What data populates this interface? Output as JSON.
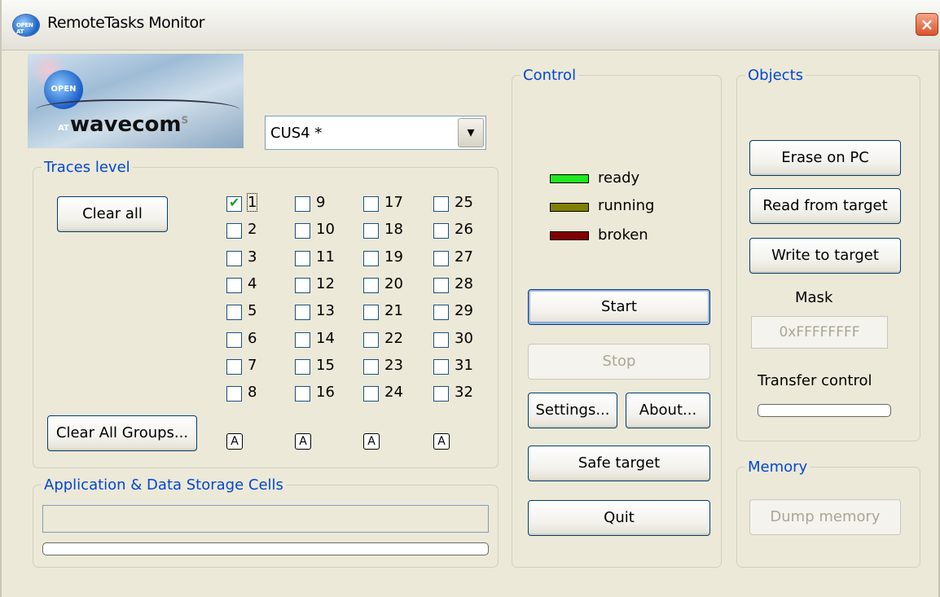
{
  "window": {
    "title": "RemoteTasks Monitor",
    "close_glyph": "×",
    "icon_text": "OPEN AT"
  },
  "logo": {
    "badge": "OPEN AT",
    "brand": "wavecom",
    "brand_superscript": "S"
  },
  "port_select": {
    "value": "CUS4 *",
    "arrow_glyph": "▾"
  },
  "traces": {
    "legend": "Traces level",
    "clear_all_label": "Clear all",
    "clear_groups_label": "Clear All Groups...",
    "group_button_label": "A",
    "levels": [
      {
        "n": "1",
        "checked": true
      },
      {
        "n": "2",
        "checked": false
      },
      {
        "n": "3",
        "checked": false
      },
      {
        "n": "4",
        "checked": false
      },
      {
        "n": "5",
        "checked": false
      },
      {
        "n": "6",
        "checked": false
      },
      {
        "n": "7",
        "checked": false
      },
      {
        "n": "8",
        "checked": false
      },
      {
        "n": "9",
        "checked": false
      },
      {
        "n": "10",
        "checked": false
      },
      {
        "n": "11",
        "checked": false
      },
      {
        "n": "12",
        "checked": false
      },
      {
        "n": "13",
        "checked": false
      },
      {
        "n": "14",
        "checked": false
      },
      {
        "n": "15",
        "checked": false
      },
      {
        "n": "16",
        "checked": false
      },
      {
        "n": "17",
        "checked": false
      },
      {
        "n": "18",
        "checked": false
      },
      {
        "n": "19",
        "checked": false
      },
      {
        "n": "20",
        "checked": false
      },
      {
        "n": "21",
        "checked": false
      },
      {
        "n": "22",
        "checked": false
      },
      {
        "n": "23",
        "checked": false
      },
      {
        "n": "24",
        "checked": false
      },
      {
        "n": "25",
        "checked": false
      },
      {
        "n": "26",
        "checked": false
      },
      {
        "n": "27",
        "checked": false
      },
      {
        "n": "28",
        "checked": false
      },
      {
        "n": "29",
        "checked": false
      },
      {
        "n": "30",
        "checked": false
      },
      {
        "n": "31",
        "checked": false
      },
      {
        "n": "32",
        "checked": false
      }
    ]
  },
  "storage": {
    "legend": "Application & Data Storage Cells",
    "field_value": "",
    "progress": 0
  },
  "control": {
    "legend": "Control",
    "status": [
      {
        "label": "ready",
        "color": "#1ee81e"
      },
      {
        "label": "running",
        "color": "#7f7f00"
      },
      {
        "label": "broken",
        "color": "#800000"
      }
    ],
    "start_label": "Start",
    "stop_label": "Stop",
    "settings_label": "Settings...",
    "about_label": "About...",
    "safe_target_label": "Safe target",
    "quit_label": "Quit"
  },
  "objects": {
    "legend": "Objects",
    "erase_label": "Erase on PC",
    "read_label": "Read from target",
    "write_label": "Write to target",
    "mask_label": "Mask",
    "mask_value": "0xFFFFFFFF",
    "transfer_label": "Transfer control",
    "transfer_progress": 0
  },
  "memory": {
    "legend": "Memory",
    "dump_label": "Dump memory"
  }
}
